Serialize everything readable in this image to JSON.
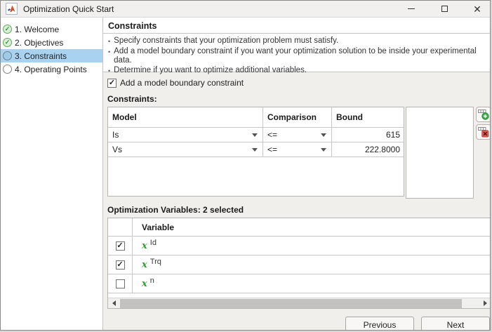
{
  "window": {
    "title": "Optimization Quick Start",
    "controls": {
      "minimize": "minimize",
      "maximize": "maximize",
      "close": "close"
    }
  },
  "sidebar": {
    "items": [
      {
        "label": "1. Welcome",
        "complete": true,
        "selected": false
      },
      {
        "label": "2. Objectives",
        "complete": true,
        "selected": false
      },
      {
        "label": "3. Constraints",
        "complete": false,
        "selected": true
      },
      {
        "label": "4. Operating Points",
        "complete": false,
        "selected": false
      }
    ]
  },
  "header": {
    "title": "Constraints",
    "bullets": [
      "Specify constraints that your optimization problem must satisfy.",
      "Add a model boundary constraint if you want your optimization solution to be inside your experimental data.",
      "Determine if you want to optimize additional variables."
    ]
  },
  "boundary_checkbox": {
    "label": "Add a model boundary constraint",
    "checked": true
  },
  "constraints_table": {
    "label": "Constraints:",
    "columns": {
      "model": "Model",
      "comparison": "Comparison",
      "bound": "Bound"
    },
    "rows": [
      {
        "model": "Is",
        "comparison": "<=",
        "bound": "615"
      },
      {
        "model": "Vs",
        "comparison": "<=",
        "bound": "222.8000"
      }
    ]
  },
  "table_buttons": {
    "add_row_icon": "add-table-row",
    "delete_row_icon": "delete-table-row"
  },
  "variables_table": {
    "label": "Optimization Variables: 2 selected",
    "column": "Variable",
    "rows": [
      {
        "name": "Id",
        "checked": true
      },
      {
        "name": "Trq",
        "checked": true
      },
      {
        "name": "n",
        "checked": false
      }
    ]
  },
  "footer": {
    "previous": "Previous",
    "next": "Next"
  },
  "colors": {
    "selection_blue": "#a8d2f0",
    "complete_green": "#5ba75b",
    "variable_green": "#2fa12f",
    "add_green": "#3fae49",
    "delete_red": "#d9534f",
    "panel_bg": "#f0efec"
  }
}
